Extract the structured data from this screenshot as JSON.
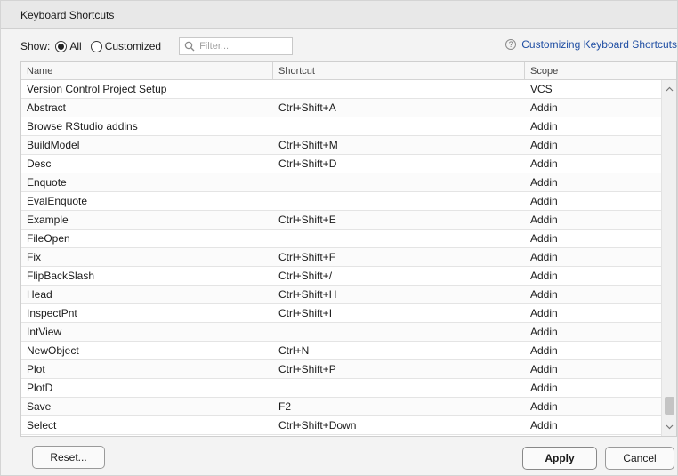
{
  "dialog": {
    "title": "Keyboard Shortcuts"
  },
  "toolbar": {
    "show_label": "Show:",
    "radio_all": "All",
    "radio_customized": "Customized",
    "filter_placeholder": "Filter...",
    "help_link": "Customizing Keyboard Shortcuts",
    "help_icon": "?"
  },
  "table": {
    "columns": [
      "Name",
      "Shortcut",
      "Scope"
    ],
    "rows": [
      {
        "name": "Version Control Project Setup",
        "shortcut": "",
        "scope": "VCS"
      },
      {
        "name": "Abstract",
        "shortcut": "Ctrl+Shift+A",
        "scope": "Addin"
      },
      {
        "name": "Browse RStudio addins",
        "shortcut": "",
        "scope": "Addin"
      },
      {
        "name": "BuildModel",
        "shortcut": "Ctrl+Shift+M",
        "scope": "Addin"
      },
      {
        "name": "Desc",
        "shortcut": "Ctrl+Shift+D",
        "scope": "Addin"
      },
      {
        "name": "Enquote",
        "shortcut": "",
        "scope": "Addin"
      },
      {
        "name": "EvalEnquote",
        "shortcut": "",
        "scope": "Addin"
      },
      {
        "name": "Example",
        "shortcut": "Ctrl+Shift+E",
        "scope": "Addin"
      },
      {
        "name": "FileOpen",
        "shortcut": "",
        "scope": "Addin"
      },
      {
        "name": "Fix",
        "shortcut": "Ctrl+Shift+F",
        "scope": "Addin"
      },
      {
        "name": "FlipBackSlash",
        "shortcut": "Ctrl+Shift+/",
        "scope": "Addin"
      },
      {
        "name": "Head",
        "shortcut": "Ctrl+Shift+H",
        "scope": "Addin"
      },
      {
        "name": "InspectPnt",
        "shortcut": "Ctrl+Shift+I",
        "scope": "Addin"
      },
      {
        "name": "IntView",
        "shortcut": "",
        "scope": "Addin"
      },
      {
        "name": "NewObject",
        "shortcut": "Ctrl+N",
        "scope": "Addin"
      },
      {
        "name": "Plot",
        "shortcut": "Ctrl+Shift+P",
        "scope": "Addin"
      },
      {
        "name": "PlotD",
        "shortcut": "",
        "scope": "Addin"
      },
      {
        "name": "Save",
        "shortcut": "F2",
        "scope": "Addin"
      },
      {
        "name": "Select",
        "shortcut": "Ctrl+Shift+Down",
        "scope": "Addin"
      }
    ]
  },
  "buttons": {
    "reset": "Reset...",
    "apply": "Apply",
    "cancel": "Cancel"
  },
  "icons": {
    "search": "search-icon",
    "help": "help-circle-icon",
    "scroll_up": "chevron-up-icon",
    "scroll_down": "chevron-down-icon"
  },
  "colors": {
    "link": "#1f4ea3",
    "dialog_bg": "#f3f3f3",
    "titlebar_bg": "#e8e8e8"
  }
}
